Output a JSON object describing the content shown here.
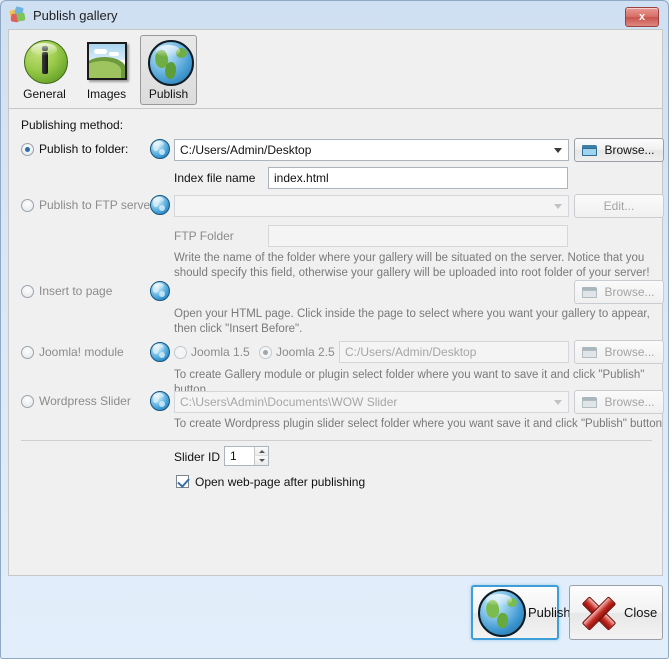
{
  "window": {
    "title": "Publish gallery",
    "title_icon": "palette-icon",
    "close_label": "x"
  },
  "tabs": [
    {
      "label": "General",
      "icon": "info-icon",
      "selected": false
    },
    {
      "label": "Images",
      "icon": "picture-icon",
      "selected": false
    },
    {
      "label": "Publish",
      "icon": "globe-icon",
      "selected": true
    }
  ],
  "panel": {
    "section_label": "Publishing method:",
    "methods": {
      "folder": {
        "label": "Publish to folder:",
        "selected": true,
        "path_value": "C:/Users/Admin/Desktop",
        "browse_label": "Browse...",
        "index_label": "Index file name",
        "index_value": "index.html"
      },
      "ftp": {
        "label": "Publish to FTP server",
        "selected": false,
        "server_value": "",
        "edit_label": "Edit...",
        "ftp_folder_label": "FTP Folder",
        "ftp_folder_value": "",
        "hint": "Write the name of the folder where your gallery will be situated on the server. Notice that you should specify this field, otherwise your gallery will be uploaded into root folder of your server!"
      },
      "insert_page": {
        "label": "Insert to page",
        "selected": false,
        "browse_label": "Browse...",
        "hint": "Open your HTML page. Click inside the page to select where you want your gallery to appear, then click \"Insert Before\"."
      },
      "joomla": {
        "label": "Joomla! module",
        "selected": false,
        "version_15_label": "Joomla 1.5",
        "version_15_selected": false,
        "version_25_label": "Joomla 2.5",
        "version_25_selected": true,
        "path_value": "C:/Users/Admin/Desktop",
        "browse_label": "Browse...",
        "hint": "To create Gallery module or plugin select folder where you want to save it and click \"Publish\" button."
      },
      "wordpress": {
        "label": "Wordpress Slider",
        "selected": false,
        "path_value": "C:\\Users\\Admin\\Documents\\WOW Slider",
        "browse_label": "Browse...",
        "hint": "To create Wordpress plugin slider select folder where you want save it and click \"Publish\" button"
      }
    },
    "slider_id_label": "Slider ID",
    "slider_id_value": "1",
    "open_webpage_label": "Open web-page after publishing",
    "open_webpage_checked": true
  },
  "footer": {
    "publish_label": "Publish",
    "close_label": "Close"
  },
  "colors": {
    "accent": "#3f9ed6",
    "close_red": "#c9534c",
    "window_bg": "#dfe9f5",
    "panel_bg": "#f0f0f0",
    "hint_text": "#7a7a7a"
  }
}
